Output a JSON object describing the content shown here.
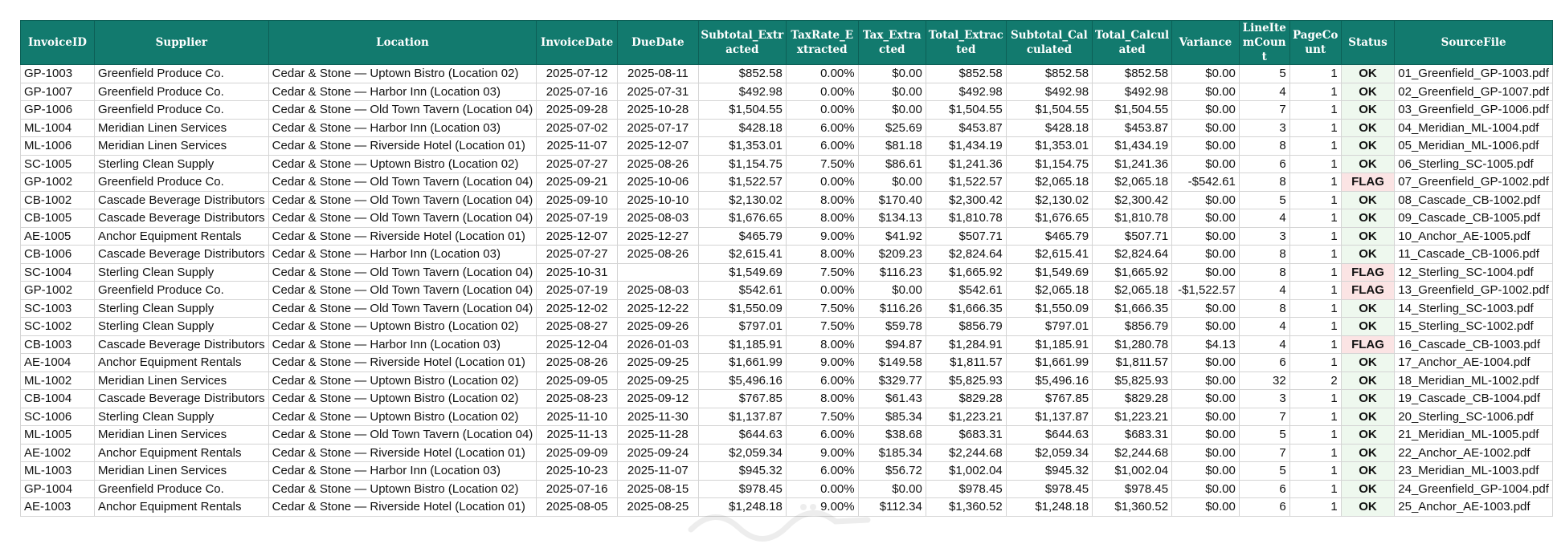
{
  "columns": [
    {
      "label": "InvoiceID",
      "width": 94,
      "align": "l"
    },
    {
      "label": "Supplier",
      "width": 204,
      "align": "l"
    },
    {
      "label": "Location",
      "width": 306,
      "align": "l"
    },
    {
      "label": "InvoiceDate",
      "width": 102,
      "align": "c"
    },
    {
      "label": "DueDate",
      "width": 102,
      "align": "c"
    },
    {
      "label": "Subtotal_Extracted",
      "width": 112,
      "align": "r"
    },
    {
      "label": "TaxRate_Extracted",
      "width": 93,
      "align": "r"
    },
    {
      "label": "Tax_Extracted",
      "width": 86,
      "align": "r"
    },
    {
      "label": "Total_Extracted",
      "width": 102,
      "align": "r"
    },
    {
      "label": "Subtotal_Calculated",
      "width": 110,
      "align": "r"
    },
    {
      "label": "Total_Calculated",
      "width": 101,
      "align": "r"
    },
    {
      "label": "Variance",
      "width": 84,
      "align": "r"
    },
    {
      "label": "LineItemCount",
      "width": 66,
      "align": "r"
    },
    {
      "label": "PageCount",
      "width": 68,
      "align": "r"
    },
    {
      "label": "Status",
      "width": 68,
      "align": "st"
    },
    {
      "label": "SourceFile",
      "width": 185,
      "align": "l"
    }
  ],
  "rows": [
    [
      "GP-1003",
      "Greenfield Produce Co.",
      "Cedar & Stone — Uptown Bistro (Location 02)",
      "2025-07-12",
      "2025-08-11",
      "$852.58",
      "0.00%",
      "$0.00",
      "$852.58",
      "$852.58",
      "$852.58",
      "$0.00",
      "5",
      "1",
      "OK",
      "01_Greenfield_GP-1003.pdf"
    ],
    [
      "GP-1007",
      "Greenfield Produce Co.",
      "Cedar & Stone — Harbor Inn (Location 03)",
      "2025-07-16",
      "2025-07-31",
      "$492.98",
      "0.00%",
      "$0.00",
      "$492.98",
      "$492.98",
      "$492.98",
      "$0.00",
      "4",
      "1",
      "OK",
      "02_Greenfield_GP-1007.pdf"
    ],
    [
      "GP-1006",
      "Greenfield Produce Co.",
      "Cedar & Stone — Old Town Tavern (Location 04)",
      "2025-09-28",
      "2025-10-28",
      "$1,504.55",
      "0.00%",
      "$0.00",
      "$1,504.55",
      "$1,504.55",
      "$1,504.55",
      "$0.00",
      "7",
      "1",
      "OK",
      "03_Greenfield_GP-1006.pdf"
    ],
    [
      "ML-1004",
      "Meridian Linen Services",
      "Cedar & Stone — Harbor Inn (Location 03)",
      "2025-07-02",
      "2025-07-17",
      "$428.18",
      "6.00%",
      "$25.69",
      "$453.87",
      "$428.18",
      "$453.87",
      "$0.00",
      "3",
      "1",
      "OK",
      "04_Meridian_ML-1004.pdf"
    ],
    [
      "ML-1006",
      "Meridian Linen Services",
      "Cedar & Stone — Riverside Hotel (Location 01)",
      "2025-11-07",
      "2025-12-07",
      "$1,353.01",
      "6.00%",
      "$81.18",
      "$1,434.19",
      "$1,353.01",
      "$1,434.19",
      "$0.00",
      "8",
      "1",
      "OK",
      "05_Meridian_ML-1006.pdf"
    ],
    [
      "SC-1005",
      "Sterling Clean Supply",
      "Cedar & Stone — Uptown Bistro (Location 02)",
      "2025-07-27",
      "2025-08-26",
      "$1,154.75",
      "7.50%",
      "$86.61",
      "$1,241.36",
      "$1,154.75",
      "$1,241.36",
      "$0.00",
      "6",
      "1",
      "OK",
      "06_Sterling_SC-1005.pdf"
    ],
    [
      "GP-1002",
      "Greenfield Produce Co.",
      "Cedar & Stone — Old Town Tavern (Location 04)",
      "2025-09-21",
      "2025-10-06",
      "$1,522.57",
      "0.00%",
      "$0.00",
      "$1,522.57",
      "$2,065.18",
      "$2,065.18",
      "-$542.61",
      "8",
      "1",
      "FLAG",
      "07_Greenfield_GP-1002.pdf"
    ],
    [
      "CB-1002",
      "Cascade Beverage Distributors",
      "Cedar & Stone — Old Town Tavern (Location 04)",
      "2025-09-10",
      "2025-10-10",
      "$2,130.02",
      "8.00%",
      "$170.40",
      "$2,300.42",
      "$2,130.02",
      "$2,300.42",
      "$0.00",
      "5",
      "1",
      "OK",
      "08_Cascade_CB-1002.pdf"
    ],
    [
      "CB-1005",
      "Cascade Beverage Distributors",
      "Cedar & Stone — Old Town Tavern (Location 04)",
      "2025-07-19",
      "2025-08-03",
      "$1,676.65",
      "8.00%",
      "$134.13",
      "$1,810.78",
      "$1,676.65",
      "$1,810.78",
      "$0.00",
      "4",
      "1",
      "OK",
      "09_Cascade_CB-1005.pdf"
    ],
    [
      "AE-1005",
      "Anchor Equipment Rentals",
      "Cedar & Stone — Riverside Hotel (Location 01)",
      "2025-12-07",
      "2025-12-27",
      "$465.79",
      "9.00%",
      "$41.92",
      "$507.71",
      "$465.79",
      "$507.71",
      "$0.00",
      "3",
      "1",
      "OK",
      "10_Anchor_AE-1005.pdf"
    ],
    [
      "CB-1006",
      "Cascade Beverage Distributors",
      "Cedar & Stone — Harbor Inn (Location 03)",
      "2025-07-27",
      "2025-08-26",
      "$2,615.41",
      "8.00%",
      "$209.23",
      "$2,824.64",
      "$2,615.41",
      "$2,824.64",
      "$0.00",
      "8",
      "1",
      "OK",
      "11_Cascade_CB-1006.pdf"
    ],
    [
      "SC-1004",
      "Sterling Clean Supply",
      "Cedar & Stone — Old Town Tavern (Location 04)",
      "2025-10-31",
      "",
      "$1,549.69",
      "7.50%",
      "$116.23",
      "$1,665.92",
      "$1,549.69",
      "$1,665.92",
      "$0.00",
      "8",
      "1",
      "FLAG",
      "12_Sterling_SC-1004.pdf"
    ],
    [
      "GP-1002",
      "Greenfield Produce Co.",
      "Cedar & Stone — Old Town Tavern (Location 04)",
      "2025-07-19",
      "2025-08-03",
      "$542.61",
      "0.00%",
      "$0.00",
      "$542.61",
      "$2,065.18",
      "$2,065.18",
      "-$1,522.57",
      "4",
      "1",
      "FLAG",
      "13_Greenfield_GP-1002.pdf"
    ],
    [
      "SC-1003",
      "Sterling Clean Supply",
      "Cedar & Stone — Old Town Tavern (Location 04)",
      "2025-12-02",
      "2025-12-22",
      "$1,550.09",
      "7.50%",
      "$116.26",
      "$1,666.35",
      "$1,550.09",
      "$1,666.35",
      "$0.00",
      "8",
      "1",
      "OK",
      "14_Sterling_SC-1003.pdf"
    ],
    [
      "SC-1002",
      "Sterling Clean Supply",
      "Cedar & Stone — Uptown Bistro (Location 02)",
      "2025-08-27",
      "2025-09-26",
      "$797.01",
      "7.50%",
      "$59.78",
      "$856.79",
      "$797.01",
      "$856.79",
      "$0.00",
      "4",
      "1",
      "OK",
      "15_Sterling_SC-1002.pdf"
    ],
    [
      "CB-1003",
      "Cascade Beverage Distributors",
      "Cedar & Stone — Harbor Inn (Location 03)",
      "2025-12-04",
      "2026-01-03",
      "$1,185.91",
      "8.00%",
      "$94.87",
      "$1,284.91",
      "$1,185.91",
      "$1,280.78",
      "$4.13",
      "4",
      "1",
      "FLAG",
      "16_Cascade_CB-1003.pdf"
    ],
    [
      "AE-1004",
      "Anchor Equipment Rentals",
      "Cedar & Stone — Riverside Hotel (Location 01)",
      "2025-08-26",
      "2025-09-25",
      "$1,661.99",
      "9.00%",
      "$149.58",
      "$1,811.57",
      "$1,661.99",
      "$1,811.57",
      "$0.00",
      "6",
      "1",
      "OK",
      "17_Anchor_AE-1004.pdf"
    ],
    [
      "ML-1002",
      "Meridian Linen Services",
      "Cedar & Stone — Uptown Bistro (Location 02)",
      "2025-09-05",
      "2025-09-25",
      "$5,496.16",
      "6.00%",
      "$329.77",
      "$5,825.93",
      "$5,496.16",
      "$5,825.93",
      "$0.00",
      "32",
      "2",
      "OK",
      "18_Meridian_ML-1002.pdf"
    ],
    [
      "CB-1004",
      "Cascade Beverage Distributors",
      "Cedar & Stone — Uptown Bistro (Location 02)",
      "2025-08-23",
      "2025-09-12",
      "$767.85",
      "8.00%",
      "$61.43",
      "$829.28",
      "$767.85",
      "$829.28",
      "$0.00",
      "3",
      "1",
      "OK",
      "19_Cascade_CB-1004.pdf"
    ],
    [
      "SC-1006",
      "Sterling Clean Supply",
      "Cedar & Stone — Uptown Bistro (Location 02)",
      "2025-11-10",
      "2025-11-30",
      "$1,137.87",
      "7.50%",
      "$85.34",
      "$1,223.21",
      "$1,137.87",
      "$1,223.21",
      "$0.00",
      "7",
      "1",
      "OK",
      "20_Sterling_SC-1006.pdf"
    ],
    [
      "ML-1005",
      "Meridian Linen Services",
      "Cedar & Stone — Old Town Tavern (Location 04)",
      "2025-11-13",
      "2025-11-28",
      "$644.63",
      "6.00%",
      "$38.68",
      "$683.31",
      "$644.63",
      "$683.31",
      "$0.00",
      "5",
      "1",
      "OK",
      "21_Meridian_ML-1005.pdf"
    ],
    [
      "AE-1002",
      "Anchor Equipment Rentals",
      "Cedar & Stone — Riverside Hotel (Location 01)",
      "2025-09-09",
      "2025-09-24",
      "$2,059.34",
      "9.00%",
      "$185.34",
      "$2,244.68",
      "$2,059.34",
      "$2,244.68",
      "$0.00",
      "7",
      "1",
      "OK",
      "22_Anchor_AE-1002.pdf"
    ],
    [
      "ML-1003",
      "Meridian Linen Services",
      "Cedar & Stone — Harbor Inn (Location 03)",
      "2025-10-23",
      "2025-11-07",
      "$945.32",
      "6.00%",
      "$56.72",
      "$1,002.04",
      "$945.32",
      "$1,002.04",
      "$0.00",
      "5",
      "1",
      "OK",
      "23_Meridian_ML-1003.pdf"
    ],
    [
      "GP-1004",
      "Greenfield Produce Co.",
      "Cedar & Stone — Uptown Bistro (Location 02)",
      "2025-07-16",
      "2025-08-15",
      "$978.45",
      "0.00%",
      "$0.00",
      "$978.45",
      "$978.45",
      "$978.45",
      "$0.00",
      "6",
      "1",
      "OK",
      "24_Greenfield_GP-1004.pdf"
    ],
    [
      "AE-1003",
      "Anchor Equipment Rentals",
      "Cedar & Stone — Riverside Hotel (Location 01)",
      "2025-08-05",
      "2025-08-25",
      "$1,248.18",
      "9.00%",
      "$112.34",
      "$1,360.52",
      "$1,248.18",
      "$1,360.52",
      "$0.00",
      "6",
      "1",
      "OK",
      "25_Anchor_AE-1003.pdf"
    ]
  ],
  "status_colors": {
    "ok_text": "#1f9d3a",
    "ok_bg": "#eef8ee",
    "flag_text": "#c1272d",
    "flag_bg": "#fbe4e4"
  },
  "header_bg": "#127a6e",
  "watermark_icon": "watermark-logo-icon"
}
